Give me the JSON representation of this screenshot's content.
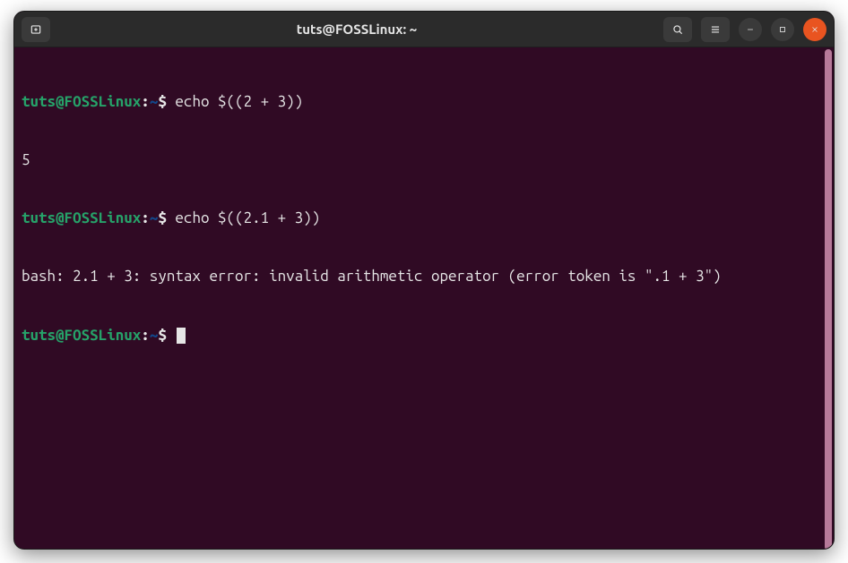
{
  "window": {
    "title": "tuts@FOSSLinux: ~"
  },
  "titlebar": {
    "new_tab": "New Tab",
    "search": "Search",
    "menu": "Menu",
    "minimize": "Minimize",
    "maximize": "Maximize",
    "close": "Close"
  },
  "prompt": {
    "user_host": "tuts@FOSSLinux",
    "sep": ":",
    "path": "~",
    "symbol": "$"
  },
  "session": {
    "lines": [
      {
        "type": "cmd",
        "text": "echo $((2 + 3))"
      },
      {
        "type": "out",
        "text": "5"
      },
      {
        "type": "cmd",
        "text": "echo $((2.1 + 3))"
      },
      {
        "type": "out",
        "text": "bash: 2.1 + 3: syntax error: invalid arithmetic operator (error token is \".1 + 3\")"
      },
      {
        "type": "cmd",
        "text": ""
      }
    ]
  }
}
